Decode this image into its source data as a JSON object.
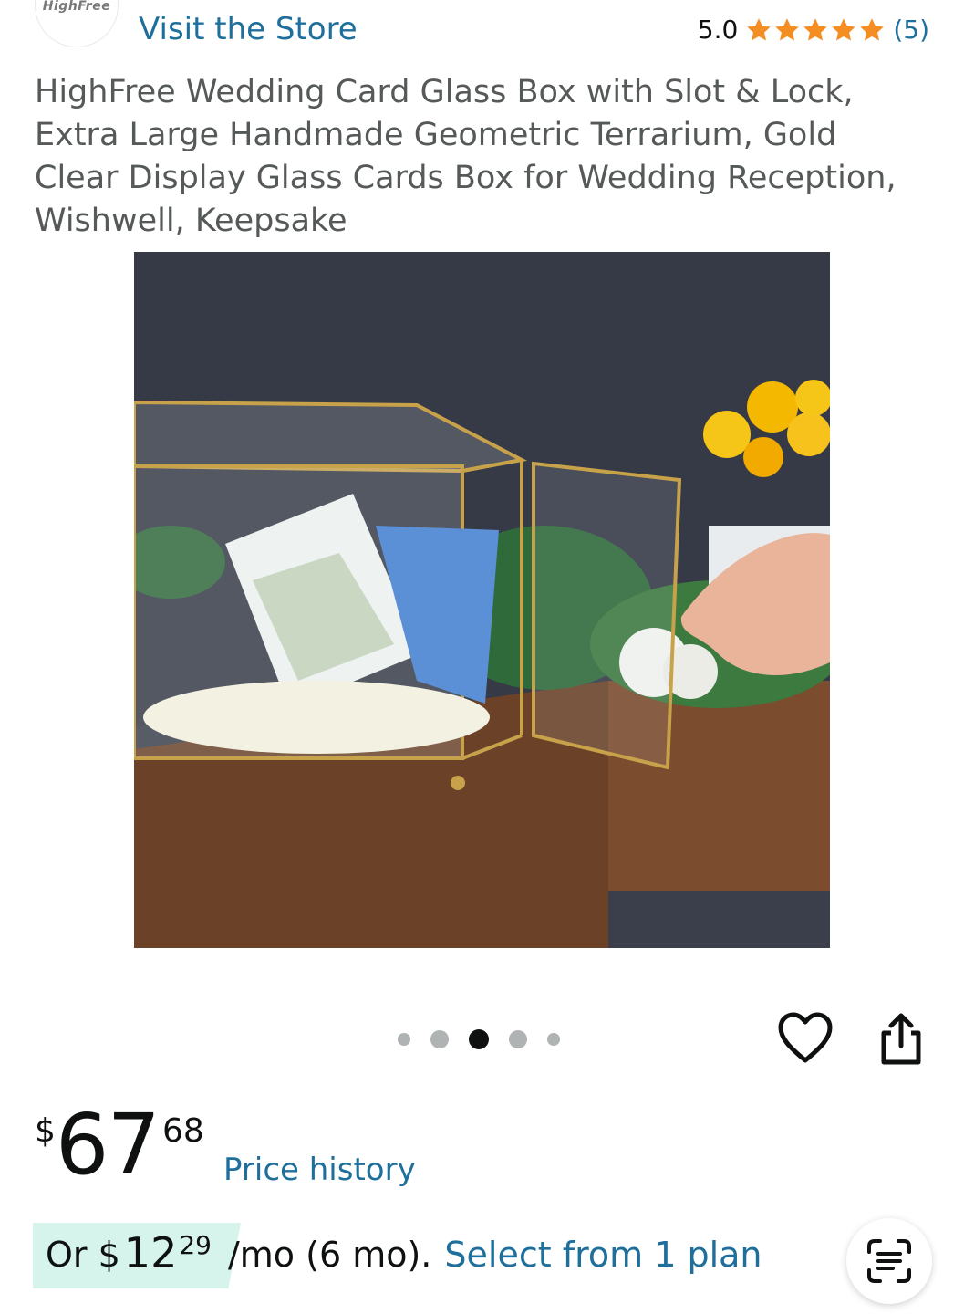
{
  "header": {
    "brand_logo_text": "HighFree",
    "store_link": "Visit the Store",
    "rating_value": "5.0",
    "rating_count": "(5)",
    "stars": 5
  },
  "product": {
    "title": "HighFree Wedding Card Glass Box with Slot & Lock, Extra Large Handmade Geometric Terrarium, Gold Clear Display Glass Cards Box for Wedding Reception, Wishwell, Keepsake",
    "image_alt_text": "",
    "carousel": {
      "count": 5,
      "active_index": 2
    }
  },
  "actions": {
    "favorite_icon": "heart-icon",
    "share_icon": "share-icon"
  },
  "price": {
    "symbol": "$",
    "whole": "67",
    "fraction": "68",
    "history_link": "Price history"
  },
  "installment": {
    "prefix": "Or $",
    "whole": "12",
    "fraction": "29",
    "terms": "/mo (6 mo).",
    "link": "Select from 1 plan"
  },
  "colors": {
    "link": "#1f6f9c",
    "star": "#f58e22",
    "installment_bg": "#d6f3ec",
    "text": "#0f1111",
    "muted": "#565959"
  }
}
